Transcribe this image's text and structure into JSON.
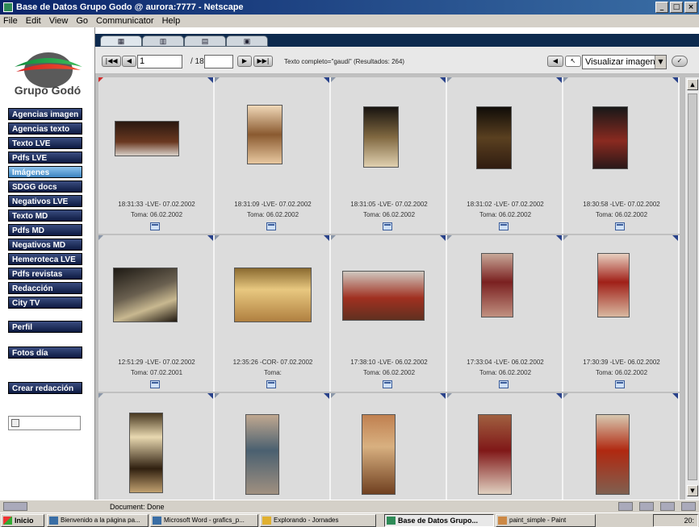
{
  "window": {
    "title": "Base de Datos Grupo Godo @ aurora:7777 - Netscape",
    "controls": [
      "_",
      "□",
      "×"
    ]
  },
  "menu": [
    "File",
    "Edit",
    "View",
    "Go",
    "Communicator",
    "Help"
  ],
  "sidebar": {
    "logo_text": "Grupo Godó",
    "nav": [
      {
        "label": "Agencias imagen",
        "active": false
      },
      {
        "label": "Agencias texto",
        "active": false
      },
      {
        "label": "Texto LVE",
        "active": false
      },
      {
        "label": "Pdfs LVE",
        "active": false
      },
      {
        "label": "Imágenes",
        "active": true
      },
      {
        "label": "SDGG docs",
        "active": false
      },
      {
        "label": "Negativos LVE",
        "active": false
      },
      {
        "label": "Texto MD",
        "active": false
      },
      {
        "label": "Pdfs MD",
        "active": false
      },
      {
        "label": "Negativos MD",
        "active": false
      },
      {
        "label": "Hemeroteca LVE",
        "active": false
      },
      {
        "label": "Pdfs revistas",
        "active": false
      },
      {
        "label": "Redacción",
        "active": false
      },
      {
        "label": "City TV",
        "active": false
      }
    ],
    "extra": [
      "Perfil",
      "Fotos día",
      "Crear redacción"
    ]
  },
  "toolbar": {
    "page_current": "1",
    "page_total": "/ 18",
    "query_text": "Texto completo=\"gaudi\" (Resultados: 264)",
    "view_select": "Visualizar imagen",
    "first": "|◀◀",
    "prev": "◀",
    "next": "▶",
    "last": "▶▶|"
  },
  "results": [
    {
      "caption1": "18:31:33 -LVE- 07.02.2002",
      "caption2": "Toma: 06.02.2002",
      "corner": "red"
    },
    {
      "caption1": "18:31:09 -LVE- 07.02.2002",
      "caption2": "Toma: 06.02.2002",
      "corner": ""
    },
    {
      "caption1": "18:31:05 -LVE- 07.02.2002",
      "caption2": "Toma: 06.02.2002",
      "corner": ""
    },
    {
      "caption1": "18:31:02 -LVE- 07.02.2002",
      "caption2": "Toma: 06.02.2002",
      "corner": ""
    },
    {
      "caption1": "18:30:58 -LVE- 07.02.2002",
      "caption2": "Toma: 06.02.2002",
      "corner": ""
    },
    {
      "caption1": "12:51:29 -LVE- 07.02.2002",
      "caption2": "Toma: 07.02.2001",
      "corner": ""
    },
    {
      "caption1": "12:35:26 -COR- 07.02.2002",
      "caption2": "Toma:",
      "corner": ""
    },
    {
      "caption1": "17:38:10 -LVE- 06.02.2002",
      "caption2": "Toma: 06.02.2002",
      "corner": ""
    },
    {
      "caption1": "17:33:04 -LVE- 06.02.2002",
      "caption2": "Toma: 06.02.2002",
      "corner": ""
    },
    {
      "caption1": "17:30:39 -LVE- 06.02.2002",
      "caption2": "Toma: 06.02.2002",
      "corner": ""
    },
    {
      "caption1": "",
      "caption2": "",
      "corner": ""
    },
    {
      "caption1": "",
      "caption2": "",
      "corner": ""
    },
    {
      "caption1": "",
      "caption2": "",
      "corner": ""
    },
    {
      "caption1": "",
      "caption2": "",
      "corner": ""
    },
    {
      "caption1": "",
      "caption2": "",
      "corner": ""
    }
  ],
  "statusbar": {
    "text": "Document: Done"
  },
  "taskbar": {
    "start": "Inicio",
    "tasks": [
      {
        "label": "Bienvenido a la página pa...",
        "active": false
      },
      {
        "label": "Microsoft Word - grafics_p...",
        "active": false
      },
      {
        "label": "Explorando - Jornades",
        "active": false
      },
      {
        "label": "Base de Datos Grupo...",
        "active": true
      },
      {
        "label": "paint_simple - Paint",
        "active": false
      }
    ],
    "clock": "20:"
  }
}
